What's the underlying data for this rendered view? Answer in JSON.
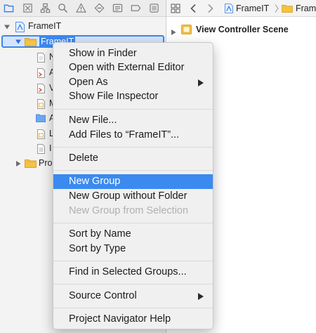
{
  "navigator": {
    "toolbar_icons": [
      "folder-icon",
      "source-control-icon",
      "hierarchy-icon",
      "search-icon",
      "warning-icon",
      "test-icon",
      "debug-icon",
      "breakpoint-icon",
      "report-icon"
    ],
    "tree": {
      "project_label": "FrameIT",
      "group_label": "FrameIT",
      "file_labels": [
        "N",
        "A",
        "V",
        "M",
        "A",
        "L",
        "I"
      ],
      "products_label": "Pro"
    }
  },
  "editor": {
    "jump_bar": {
      "project_label": "FrameIT",
      "folder_label": "Fram"
    },
    "scene_label": "View Controller Scene"
  },
  "context_menu": {
    "items": [
      {
        "label": "Show in Finder"
      },
      {
        "label": "Open with External Editor"
      },
      {
        "label": "Open As"
      },
      {
        "label": "Show File Inspector"
      },
      {
        "label": "New File..."
      },
      {
        "label": "Add Files to “FrameIT”..."
      },
      {
        "label": "Delete"
      },
      {
        "label": "New Group"
      },
      {
        "label": "New Group without Folder"
      },
      {
        "label": "New Group from Selection"
      },
      {
        "label": "Sort by Name"
      },
      {
        "label": "Sort by Type"
      },
      {
        "label": "Find in Selected Groups..."
      },
      {
        "label": "Source Control"
      },
      {
        "label": "Project Navigator Help"
      }
    ],
    "highlighted_item": "New Group",
    "disabled_item": "New Group from Selection",
    "submenu_items": [
      "Open As",
      "Source Control"
    ]
  },
  "colors": {
    "selection_blue": "#3b8aef",
    "folder_yellow": "#f5c243",
    "xcode_blue": "#3d86f0"
  }
}
